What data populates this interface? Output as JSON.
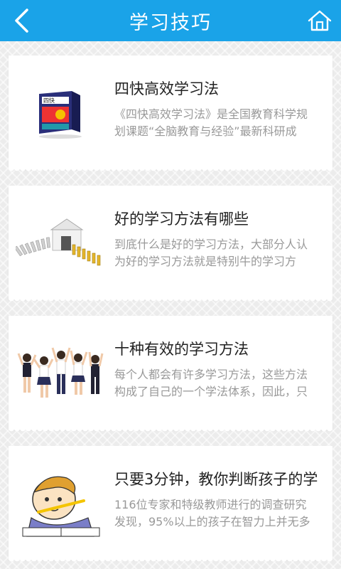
{
  "header": {
    "title": "学习技巧",
    "back_icon": "chevron-left-icon",
    "home_icon": "home-icon",
    "color": "#1aa3e8"
  },
  "articles": [
    {
      "title": "四快高效学习法",
      "desc_line1": "《四快高效学习法》是全国教育科学规",
      "desc_line2": "划课题“全脑教育与经验”最新科研成",
      "thumb_label": "四快"
    },
    {
      "title": "好的学习方法有哪些",
      "desc_line1": "到底什么是好的学习方法，大部分人认",
      "desc_line2": "为好的学习方法就是特别牛的学习方"
    },
    {
      "title": "十种有效的学习方法",
      "desc_line1": "每个人都会有许多学习方法，这些方法",
      "desc_line2": "构成了自己的一个学法体系，因此，只"
    },
    {
      "title": "只要3分钟，教你判断孩子的学",
      "desc_line1": "116位专家和特级教师进行的调查研究",
      "desc_line2": "发现，95%以上的孩子在智力上并无多"
    }
  ]
}
